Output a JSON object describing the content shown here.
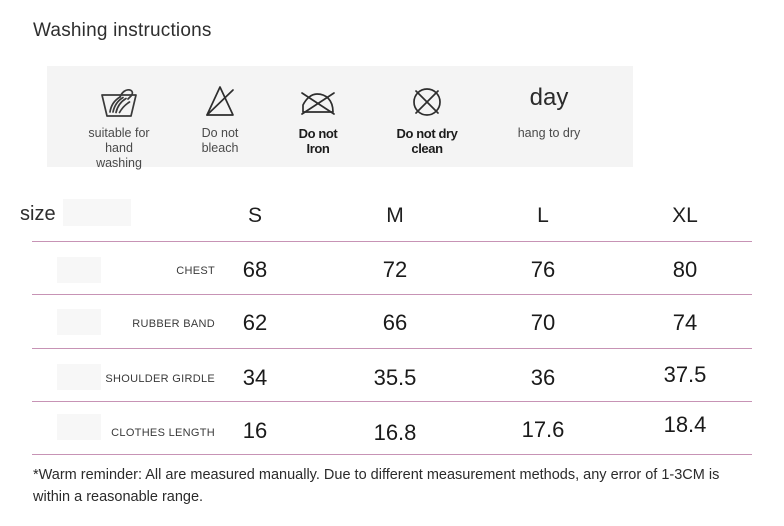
{
  "washing": {
    "title": "Washing instructions",
    "items": [
      {
        "icon": "hand-wash-basin-icon",
        "label": "suitable for\nhand washing",
        "style": "light",
        "word": ""
      },
      {
        "icon": "do-not-bleach-triangle-icon",
        "label": "Do not bleach",
        "style": "light",
        "word": ""
      },
      {
        "icon": "do-not-iron-icon",
        "label": "Do not Iron",
        "style": "strong",
        "word": ""
      },
      {
        "icon": "do-not-dry-clean-circle-icon",
        "label": "Do not dry clean",
        "style": "strong",
        "word": ""
      },
      {
        "icon": "hang-to-dry-text-icon",
        "label": "hang to dry",
        "style": "light",
        "word": "day"
      }
    ]
  },
  "size_table": {
    "heading": "size",
    "columns": [
      "S",
      "M",
      "L",
      "XL"
    ],
    "rows": [
      {
        "label": "CHEST",
        "values": [
          "68",
          "72",
          "76",
          "80"
        ]
      },
      {
        "label": "RUBBER BAND",
        "values": [
          "62",
          "66",
          "70",
          "74"
        ]
      },
      {
        "label": "SHOULDER GIRDLE",
        "values": [
          "34",
          "35.5",
          "36",
          "37.5"
        ]
      },
      {
        "label": "CLOTHES LENGTH",
        "values": [
          "16",
          "16.8",
          "17.6",
          "18.4"
        ]
      }
    ],
    "line_color": "#c793b5"
  },
  "footnote": {
    "text": "*Warm reminder: All are measured manually. Due to different measurement methods, any error of 1-3CM is within a reasonable range."
  }
}
